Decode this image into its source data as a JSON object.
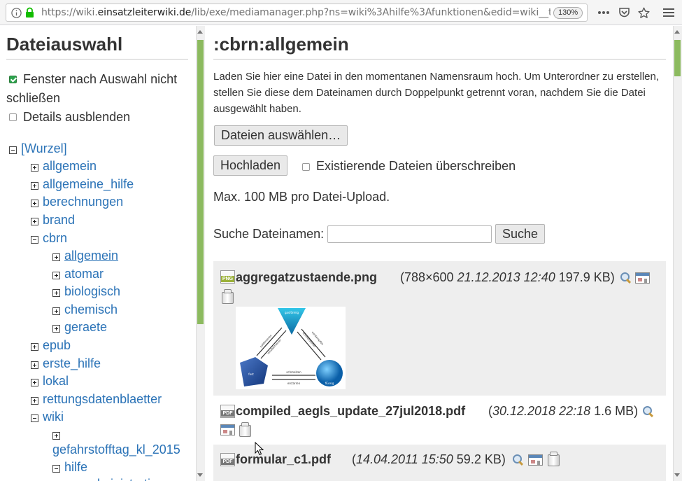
{
  "browser": {
    "url_prefix": "https://wiki.",
    "url_domain": "einsatzleiterwiki.de",
    "url_suffix": "/lib/exe/mediamanager.php?ns=wiki%3Ahilfe%3Afunktionen&edid=wiki__t",
    "zoom": "130%",
    "icons": [
      "info-icon",
      "lock-icon",
      "more-icon",
      "pocket-icon",
      "star-icon",
      "menu-icon"
    ]
  },
  "left": {
    "title": "Dateiauswahl",
    "opt_keep_open": "Fenster nach Auswahl nicht schließen",
    "opt_keep_open_l1": "Fenster nach Auswahl nicht",
    "opt_keep_open_l2": "schließen",
    "opt_keep_open_checked": true,
    "opt_hide_details": "Details ausblenden",
    "opt_hide_details_checked": false,
    "tree": [
      {
        "label": "[Wurzel]",
        "expanded": true,
        "level": 0
      },
      {
        "label": "allgemein",
        "expanded": false,
        "level": 1
      },
      {
        "label": "allgemeine_hilfe",
        "expanded": false,
        "level": 1
      },
      {
        "label": "berechnungen",
        "expanded": false,
        "level": 1
      },
      {
        "label": "brand",
        "expanded": false,
        "level": 1
      },
      {
        "label": "cbrn",
        "expanded": true,
        "level": 1
      },
      {
        "label": "allgemein",
        "expanded": false,
        "level": 2,
        "current": true
      },
      {
        "label": "atomar",
        "expanded": false,
        "level": 2
      },
      {
        "label": "biologisch",
        "expanded": false,
        "level": 2
      },
      {
        "label": "chemisch",
        "expanded": false,
        "level": 2
      },
      {
        "label": "geraete",
        "expanded": false,
        "level": 2
      },
      {
        "label": "epub",
        "expanded": false,
        "level": 1
      },
      {
        "label": "erste_hilfe",
        "expanded": false,
        "level": 1
      },
      {
        "label": "lokal",
        "expanded": false,
        "level": 1
      },
      {
        "label": "rettungsdatenblaetter",
        "expanded": false,
        "level": 1
      },
      {
        "label": "wiki",
        "expanded": true,
        "level": 1
      },
      {
        "label": "gefahrstofftag_kl_2015",
        "expanded": false,
        "level": 2
      },
      {
        "label": "hilfe",
        "expanded": true,
        "level": 2
      },
      {
        "label": "administration",
        "expanded": false,
        "level": 3
      }
    ]
  },
  "right": {
    "title": ":cbrn:allgemein",
    "upload_text": "Laden Sie hier eine Datei in den momentanen Namensraum hoch. Um Unterordner zu erstellen, stellen Sie diese dem Dateinamen durch Doppelpunkt getrennt voran, nachdem Sie die Datei ausgewählt haben.",
    "choose_button": "Dateien auswählen…",
    "upload_button": "Hochladen",
    "overwrite_label": "Existierende Dateien überschreiben",
    "overwrite_checked": false,
    "max_size": "Max. 100 MB pro Datei-Upload.",
    "search_label": "Suche Dateinamen:",
    "search_value": "",
    "search_button": "Suche",
    "files": [
      {
        "name": "aggregatzustaende.png",
        "type": "PNG",
        "meta_open": "(788×600 ",
        "date": "21.12.2013 12:40",
        "meta_close": " 197.9 KB)",
        "has_thumb": true,
        "thumb_labels": [
          "gasförmig",
          "fest",
          "flüssig",
          "schmelzen",
          "erstarren",
          "kondensieren",
          "verdampfen",
          "sublimieren",
          "resublimieren"
        ]
      },
      {
        "name": "compiled_aegls_update_27jul2018.pdf",
        "type": "PDF",
        "meta_open": "(",
        "date": "30.12.2018 22:18",
        "meta_close": " 1.6 MB)"
      },
      {
        "name": "formular_c1.pdf",
        "type": "PDF",
        "meta_open": "(",
        "date": "14.04.2011 15:50",
        "meta_close": " 59.2 KB)"
      }
    ]
  },
  "colors": {
    "link": "#2b73b7",
    "accent": "#8cba5f",
    "check": "#2ea44f"
  }
}
